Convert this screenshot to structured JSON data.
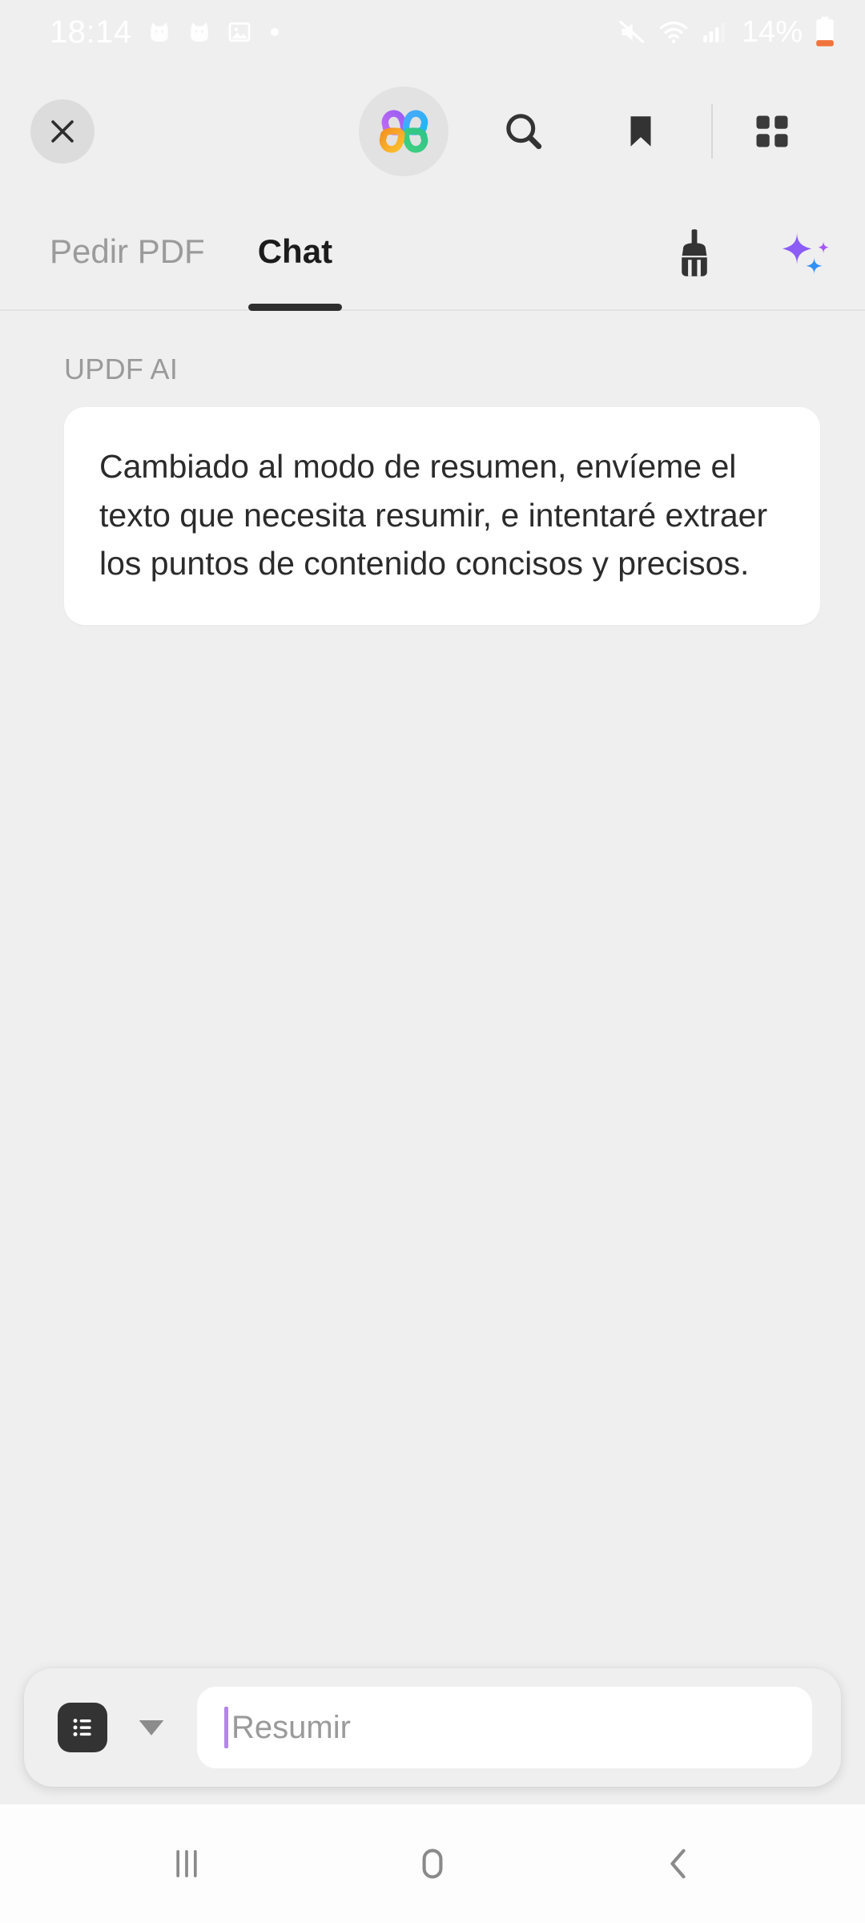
{
  "status_bar": {
    "time": "18:14",
    "battery_percent": "14%",
    "left_icons": [
      "cat-app-icon",
      "cat-app-icon",
      "gallery-image-icon",
      "dot-indicator-icon"
    ],
    "right_icons": [
      "mute-icon",
      "wifi-icon",
      "cellular-signal-icon",
      "battery-icon"
    ],
    "text_color": "#ffffff",
    "battery_accent": "#f0733c"
  },
  "toolbar": {
    "close_label": "close-icon",
    "logo_label": "updf-ai-clover-logo",
    "search_label": "search-icon",
    "bookmark_label": "bookmark-icon",
    "grid_label": "grid-apps-icon",
    "logo_colors": {
      "top_left": "#a855f7",
      "top_right": "#3b9df8",
      "bottom_right": "#34c77b",
      "bottom_left": "#f9b915"
    }
  },
  "tabs": [
    {
      "label": "Pedir PDF",
      "active": false
    },
    {
      "label": "Chat",
      "active": true
    }
  ],
  "tab_actions": [
    {
      "name": "clear-chat-brush-icon",
      "color": "#333333"
    },
    {
      "name": "ai-sparkles-icon",
      "color": "#8b5cf6"
    }
  ],
  "chat": {
    "messages": [
      {
        "sender": "UPDF AI",
        "text": "Cambiado al modo de resumen, envíeme el texto que necesita resumir, e intentaré extraer los puntos de contenido concisos y precisos."
      }
    ]
  },
  "input_bar": {
    "list_icon": "list-menu-icon",
    "caret_icon": "chevron-down-icon",
    "placeholder": "Resumir",
    "value": "",
    "cursor_color": "#b385e8"
  },
  "nav_bar": {
    "recents_label": "recents-icon",
    "home_label": "home-icon",
    "back_label": "back-icon",
    "color": "#8a8a8a"
  },
  "colors": {
    "background": "#efefef",
    "bubble": "#ffffff",
    "accent_purple": "#8b5cf6",
    "accent_blue": "#2f90f5"
  }
}
